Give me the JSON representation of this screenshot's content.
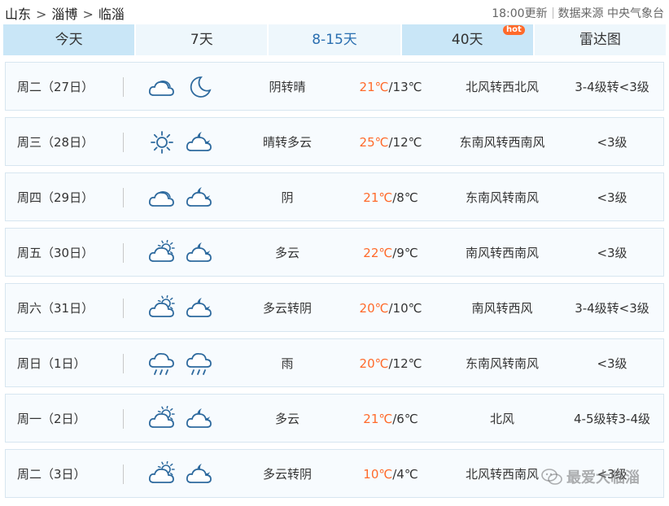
{
  "breadcrumb": {
    "province": "山东",
    "city": "淄博",
    "district": "临淄",
    "separator": ">"
  },
  "meta": {
    "update_time": "18:00更新",
    "source": "数据来源 中央气象台"
  },
  "tabs": [
    {
      "label": "今天"
    },
    {
      "label": "7天"
    },
    {
      "label": "8-15天"
    },
    {
      "label": "40天",
      "badge": "hot"
    },
    {
      "label": "雷达图"
    }
  ],
  "active_tab": "8-15天",
  "colors": {
    "high_temp": "#ff6a2a",
    "tab_bg": "#c9e6f7",
    "tab_active": "#2a6fb0",
    "icon_stroke": "#2e6a9e"
  },
  "forecast": [
    {
      "day": "周二（27日）",
      "icon_day": "cloudy-icon",
      "icon_night": "moon-icon",
      "desc": "阴转晴",
      "high": "21℃",
      "low": "/13℃",
      "wind": "北风转西北风",
      "force": "3-4级转<3级"
    },
    {
      "day": "周三（28日）",
      "icon_day": "sun-icon",
      "icon_night": "cloud-moon-icon",
      "desc": "晴转多云",
      "high": "25℃",
      "low": "/12℃",
      "wind": "东南风转西南风",
      "force": "<3级"
    },
    {
      "day": "周四（29日）",
      "icon_day": "cloudy-icon",
      "icon_night": "cloud-moon-icon",
      "desc": "阴",
      "high": "21℃",
      "low": "/8℃",
      "wind": "东南风转南风",
      "force": "<3级"
    },
    {
      "day": "周五（30日）",
      "icon_day": "partly-cloudy-icon",
      "icon_night": "cloud-moon-icon",
      "desc": "多云",
      "high": "22℃",
      "low": "/9℃",
      "wind": "南风转西南风",
      "force": "<3级"
    },
    {
      "day": "周六（31日）",
      "icon_day": "partly-cloudy-icon",
      "icon_night": "cloud-moon-icon",
      "desc": "多云转阴",
      "high": "20℃",
      "low": "/10℃",
      "wind": "南风转西风",
      "force": "3-4级转<3级"
    },
    {
      "day": "周日（1日）",
      "icon_day": "rain-icon",
      "icon_night": "rain-icon",
      "desc": "雨",
      "high": "20℃",
      "low": "/12℃",
      "wind": "东南风转南风",
      "force": "<3级"
    },
    {
      "day": "周一（2日）",
      "icon_day": "partly-cloudy-icon",
      "icon_night": "cloud-moon-icon",
      "desc": "多云",
      "high": "21℃",
      "low": "/6℃",
      "wind": "北风",
      "force": "4-5级转3-4级"
    },
    {
      "day": "周二（3日）",
      "icon_day": "partly-cloudy-icon",
      "icon_night": "cloud-moon-icon",
      "desc": "多云转阴",
      "high": "10℃",
      "low": "/4℃",
      "wind": "北风转西南风",
      "force": "<3级"
    }
  ],
  "watermark": {
    "text": "最爱大临淄"
  }
}
